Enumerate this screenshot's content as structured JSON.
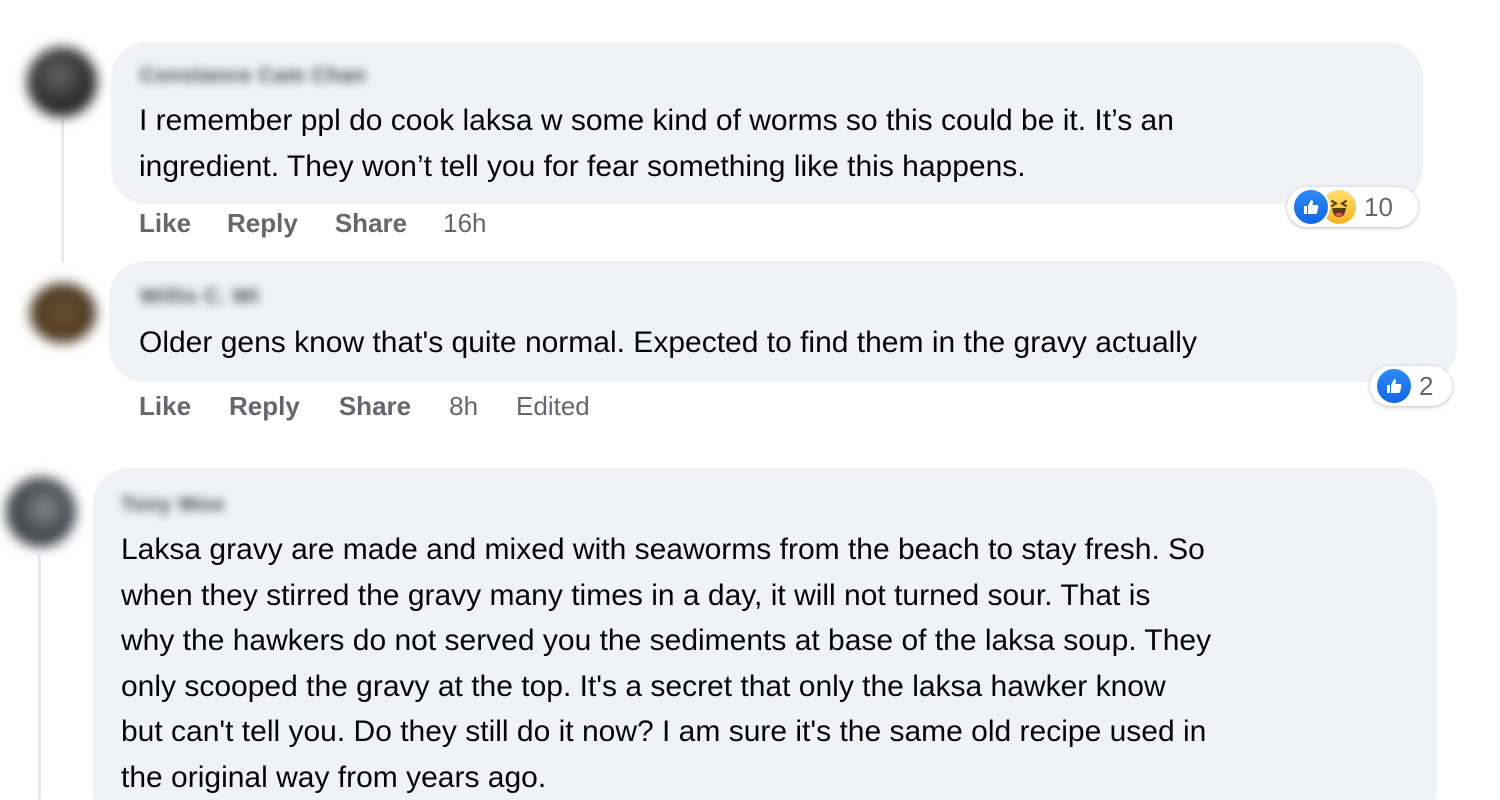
{
  "comments": [
    {
      "author": "Constance Cam Chan",
      "text_lines": [
        "I remember ppl do cook laksa w some kind of worms so this could be it. It’s an",
        "ingredient. They won’t tell you for fear something like this happens."
      ],
      "actions": {
        "like": "Like",
        "reply": "Reply",
        "share": "Share",
        "time": "16h"
      },
      "reactions": {
        "icons": [
          "like-icon",
          "haha-icon"
        ],
        "count": "10"
      },
      "avatar_color": "#3a3a3a"
    },
    {
      "author": "Willis C. WI",
      "text_lines": [
        "Older gens know that's quite normal. Expected to find them in the gravy actually"
      ],
      "actions": {
        "like": "Like",
        "reply": "Reply",
        "share": "Share",
        "time": "8h",
        "edited": "Edited"
      },
      "reactions": {
        "icons": [
          "like-icon"
        ],
        "count": "2"
      },
      "avatar_color": "#6b5233"
    },
    {
      "author": "Tony Woo",
      "text_lines": [
        "Laksa gravy are made and mixed with seaworms from the beach to stay fresh. So",
        "when they stirred the gravy many times in a day, it will not turned sour. That is",
        "why the hawkers do not served you the sediments at base of the laksa soup. They",
        "only scooped the gravy at the top. It's a secret that only the laksa hawker know",
        "but can't tell you. Do they still do it now? I am sure it's the same old recipe used in",
        "the original way from years ago."
      ],
      "avatar_color": "#3d4048"
    }
  ],
  "colors": {
    "bubble": "#f0f2f5",
    "action_text": "#65676b",
    "like_blue": "#1877f2",
    "haha_yellow": "#f7b928"
  }
}
